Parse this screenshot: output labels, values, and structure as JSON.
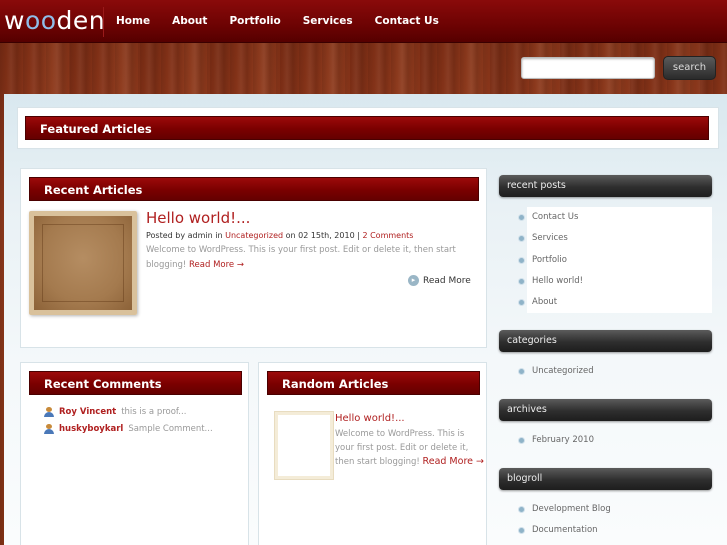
{
  "site": {
    "logo_a": "w",
    "logo_oo": "oo",
    "logo_b": "den"
  },
  "nav": [
    "Home",
    "About",
    "Portfolio",
    "Services",
    "Contact Us"
  ],
  "search": {
    "placeholder": "",
    "button": "search"
  },
  "featured": {
    "title": "Featured Articles"
  },
  "recent": {
    "title": "Recent Articles",
    "post": {
      "title": "Hello world!...",
      "meta_prefix": "Posted by admin in ",
      "category": "Uncategorized",
      "meta_date": " on 02 15th, 2010 | ",
      "comments": "2 Comments",
      "excerpt": "Welcome to WordPress. This is your first post. Edit or delete it, then start blogging! ",
      "more": "Read More →",
      "read_more": "Read More"
    }
  },
  "comments": {
    "title": "Recent Comments",
    "items": [
      {
        "author": "Roy Vincent",
        "text": "this is a proof..."
      },
      {
        "author": "huskyboykarl",
        "text": "Sample Comment..."
      }
    ]
  },
  "random": {
    "title": "Random Articles",
    "post": {
      "title": "Hello world!...",
      "excerpt": "Welcome to WordPress. This is your first post. Edit or delete it, then start blogging! ",
      "more": "Read More →"
    }
  },
  "sidebar": {
    "recent_posts": {
      "title": "recent posts",
      "items": [
        "Contact Us",
        "Services",
        "Portfolio",
        "Hello world!",
        "About"
      ]
    },
    "categories": {
      "title": "categories",
      "items": [
        "Uncategorized"
      ]
    },
    "archives": {
      "title": "archives",
      "items": [
        "February 2010"
      ]
    },
    "blogroll": {
      "title": "blogroll",
      "items": [
        "Development Blog",
        "Documentation"
      ]
    }
  },
  "colors": {
    "accent": "#b02020",
    "nav_bg": "#6d0303",
    "bar_bg": "#7a0000"
  }
}
